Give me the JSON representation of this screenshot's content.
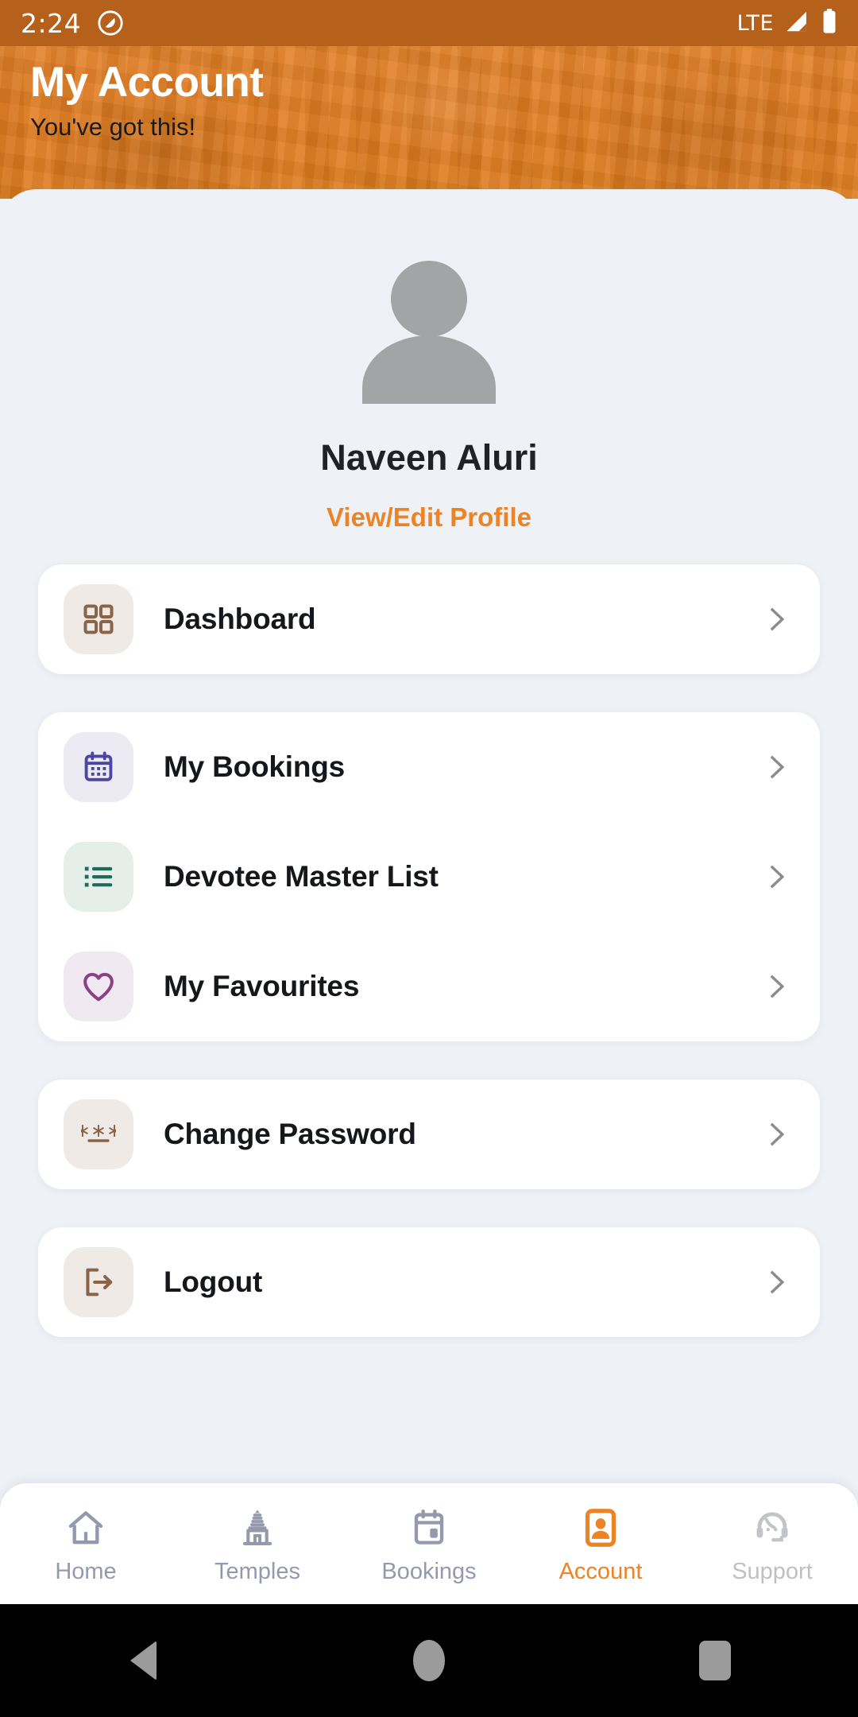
{
  "status_bar": {
    "time": "2:24",
    "dnd_icon": "do-not-disturb-icon",
    "network_label": "LTE",
    "signal_icon": "signal-bars-icon",
    "battery_icon": "battery-full-icon"
  },
  "header": {
    "title": "My Account",
    "subtitle": "You've got this!",
    "background_color": "#e07c20"
  },
  "profile": {
    "avatar_icon": "person-placeholder-avatar",
    "name": "Naveen Aluri",
    "edit_link": "View/Edit Profile",
    "edit_link_color": "#ec8325"
  },
  "menu_groups": [
    {
      "items": [
        {
          "label": "Dashboard",
          "icon": "grid-dashboard-icon",
          "icon_color": "#8a6446",
          "tile_color": "#f0eae6",
          "chevron": "chevron-right-icon"
        }
      ]
    },
    {
      "items": [
        {
          "label": "My Bookings",
          "icon": "calendar-icon",
          "icon_color": "#4c46a0",
          "tile_color": "#eceaf2",
          "chevron": "chevron-right-icon"
        },
        {
          "label": "Devotee Master List",
          "icon": "list-bullet-icon",
          "icon_color": "#1f6b5c",
          "tile_color": "#e6eeea",
          "chevron": "chevron-right-icon"
        },
        {
          "label": "My Favourites",
          "icon": "heart-outline-icon",
          "icon_color": "#8d3f86",
          "tile_color": "#f1e9f1",
          "chevron": "chevron-right-icon"
        }
      ]
    },
    {
      "items": [
        {
          "label": "Change Password",
          "icon": "asterisks-password-icon",
          "icon_color": "#8a6446",
          "tile_color": "#f0eae6",
          "chevron": "chevron-right-icon"
        }
      ]
    },
    {
      "items": [
        {
          "label": "Logout",
          "icon": "logout-arrow-icon",
          "icon_color": "#8a6446",
          "tile_color": "#f0eae6",
          "chevron": "chevron-right-icon"
        }
      ]
    }
  ],
  "bottom_nav": {
    "active_color": "#ec8325",
    "inactive_color": "#9499ad",
    "items": [
      {
        "label": "Home",
        "icon": "home-icon",
        "state": "inactive"
      },
      {
        "label": "Temples",
        "icon": "temple-gopuram-icon",
        "state": "inactive"
      },
      {
        "label": "Bookings",
        "icon": "calendar-bookings-icon",
        "state": "inactive"
      },
      {
        "label": "Account",
        "icon": "account-id-card-icon",
        "state": "active"
      },
      {
        "label": "Support",
        "icon": "headset-support-icon",
        "state": "muted"
      }
    ]
  },
  "system_nav": {
    "back_icon": "back-triangle-icon",
    "home_icon": "home-circle-icon",
    "recents_icon": "recents-square-icon"
  }
}
